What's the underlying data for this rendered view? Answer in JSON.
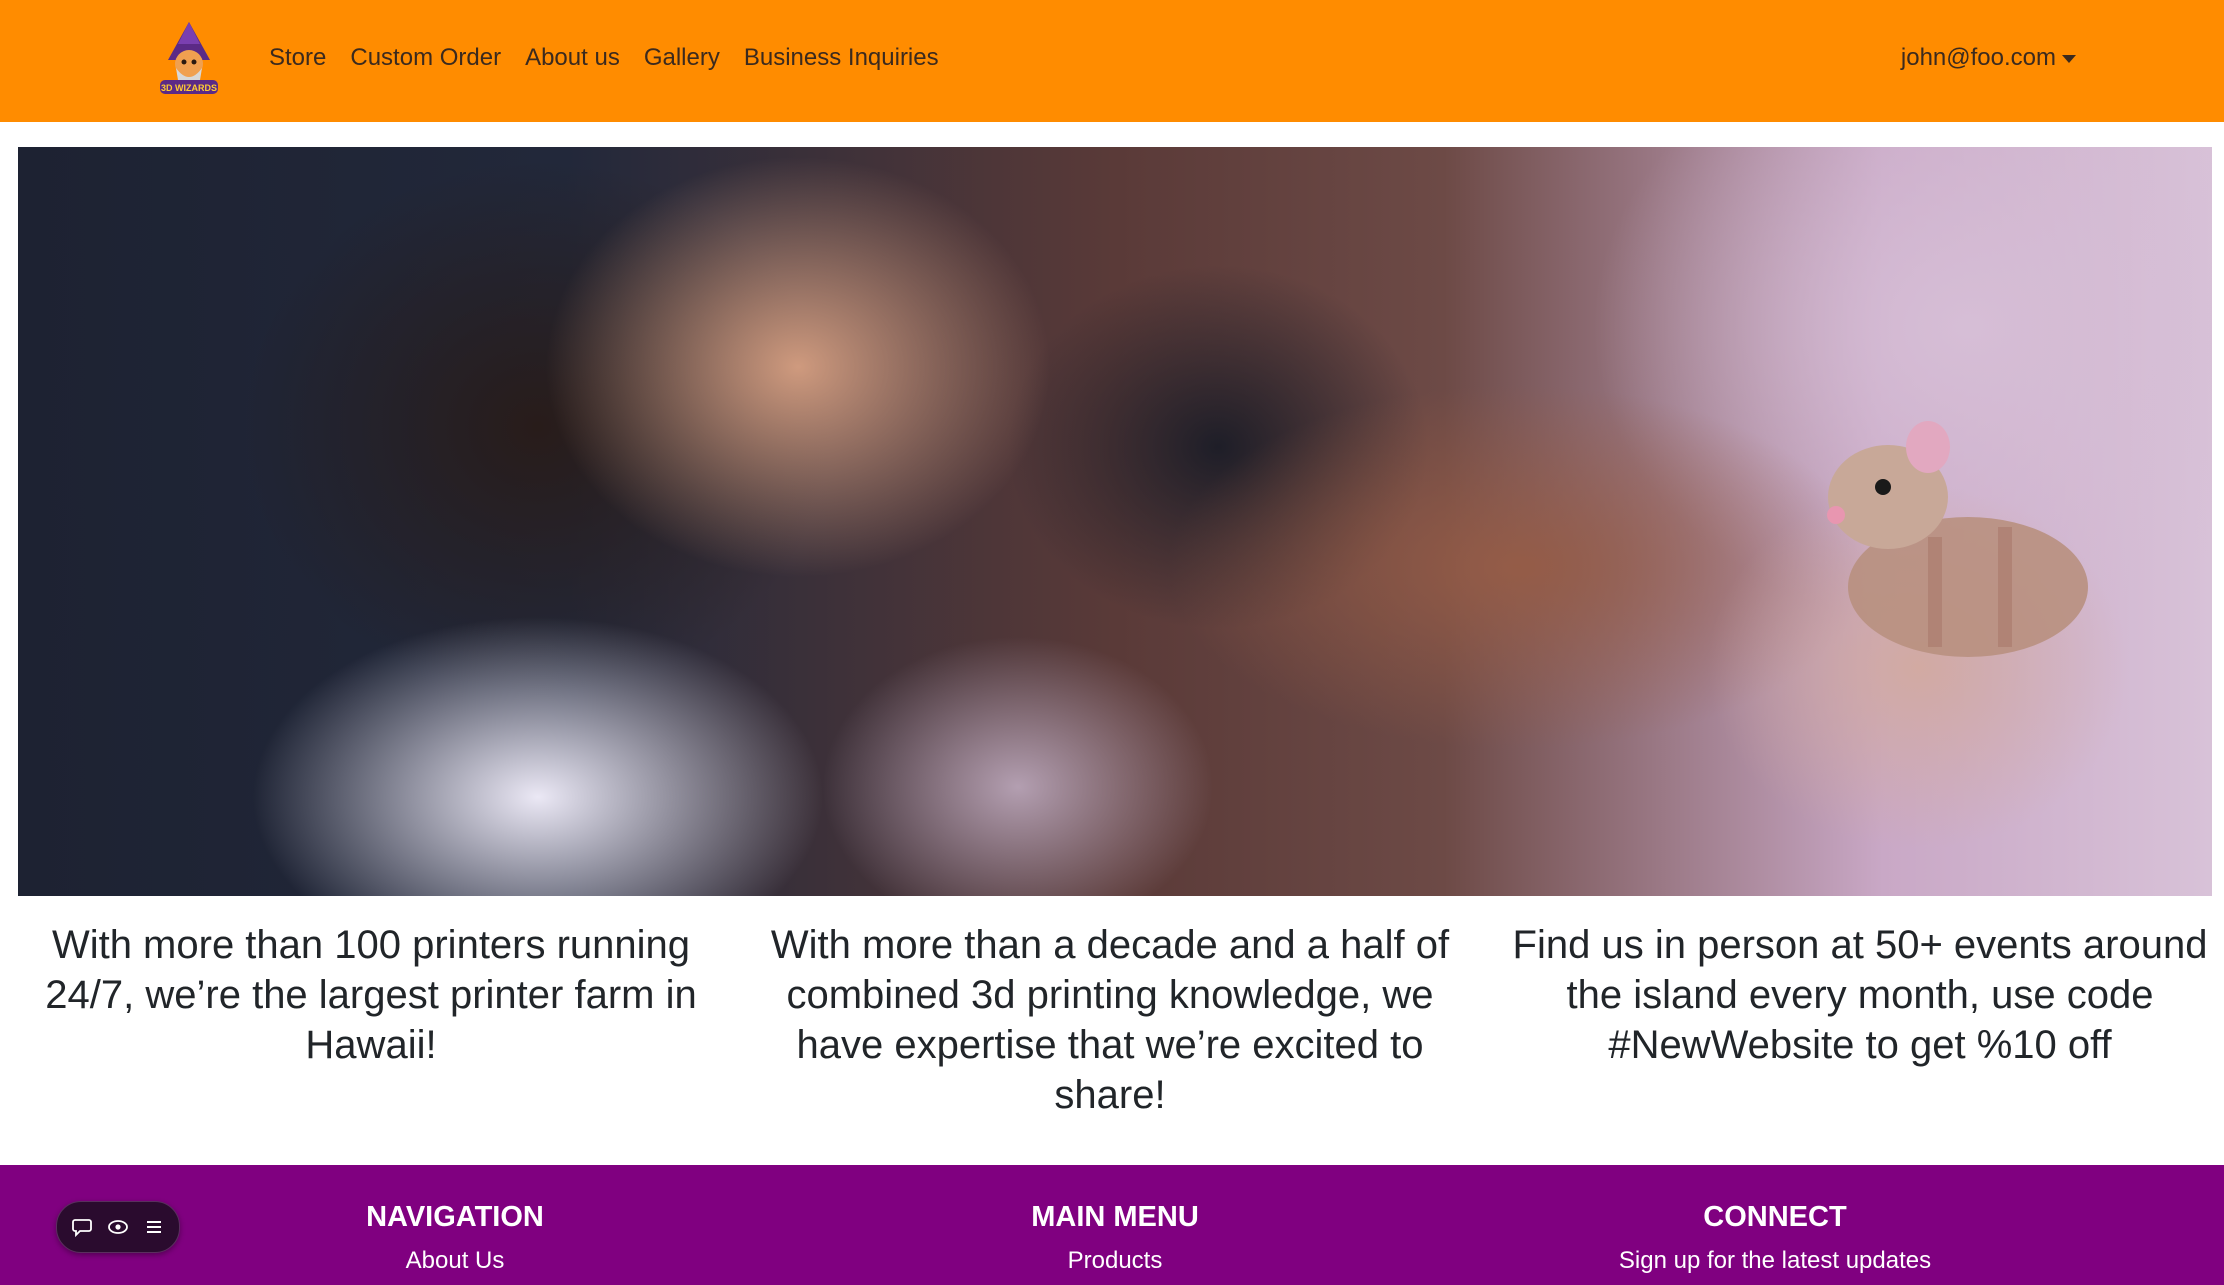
{
  "brand": {
    "logo_text": "3D WIZARDS"
  },
  "navbar": {
    "links": [
      "Store",
      "Custom Order",
      "About us",
      "Gallery",
      "Business Inquiries"
    ],
    "user_email": "john@foo.com"
  },
  "features": [
    "With more than 100 printers running 24/7, we’re the largest printer farm in Hawaii!",
    "With more than a decade and a half of combined 3d printing knowledge, we have expertise that we’re excited to share!",
    "Find us in person at 50+ events around the island every month, use code #NewWebsite to get %10 off"
  ],
  "footer": {
    "columns": [
      {
        "heading": "NAVIGATION",
        "link": "About Us"
      },
      {
        "heading": "MAIN MENU",
        "link": "Products"
      },
      {
        "heading": "CONNECT",
        "link": "Sign up for the latest updates"
      }
    ]
  },
  "floating_toolbar": {
    "icons": [
      "chat-bubble-icon",
      "eye-icon",
      "menu-lines-icon"
    ]
  },
  "colors": {
    "navbar": "#ff8c00",
    "footer": "#800080",
    "toolbar": "#2a0b2e"
  }
}
